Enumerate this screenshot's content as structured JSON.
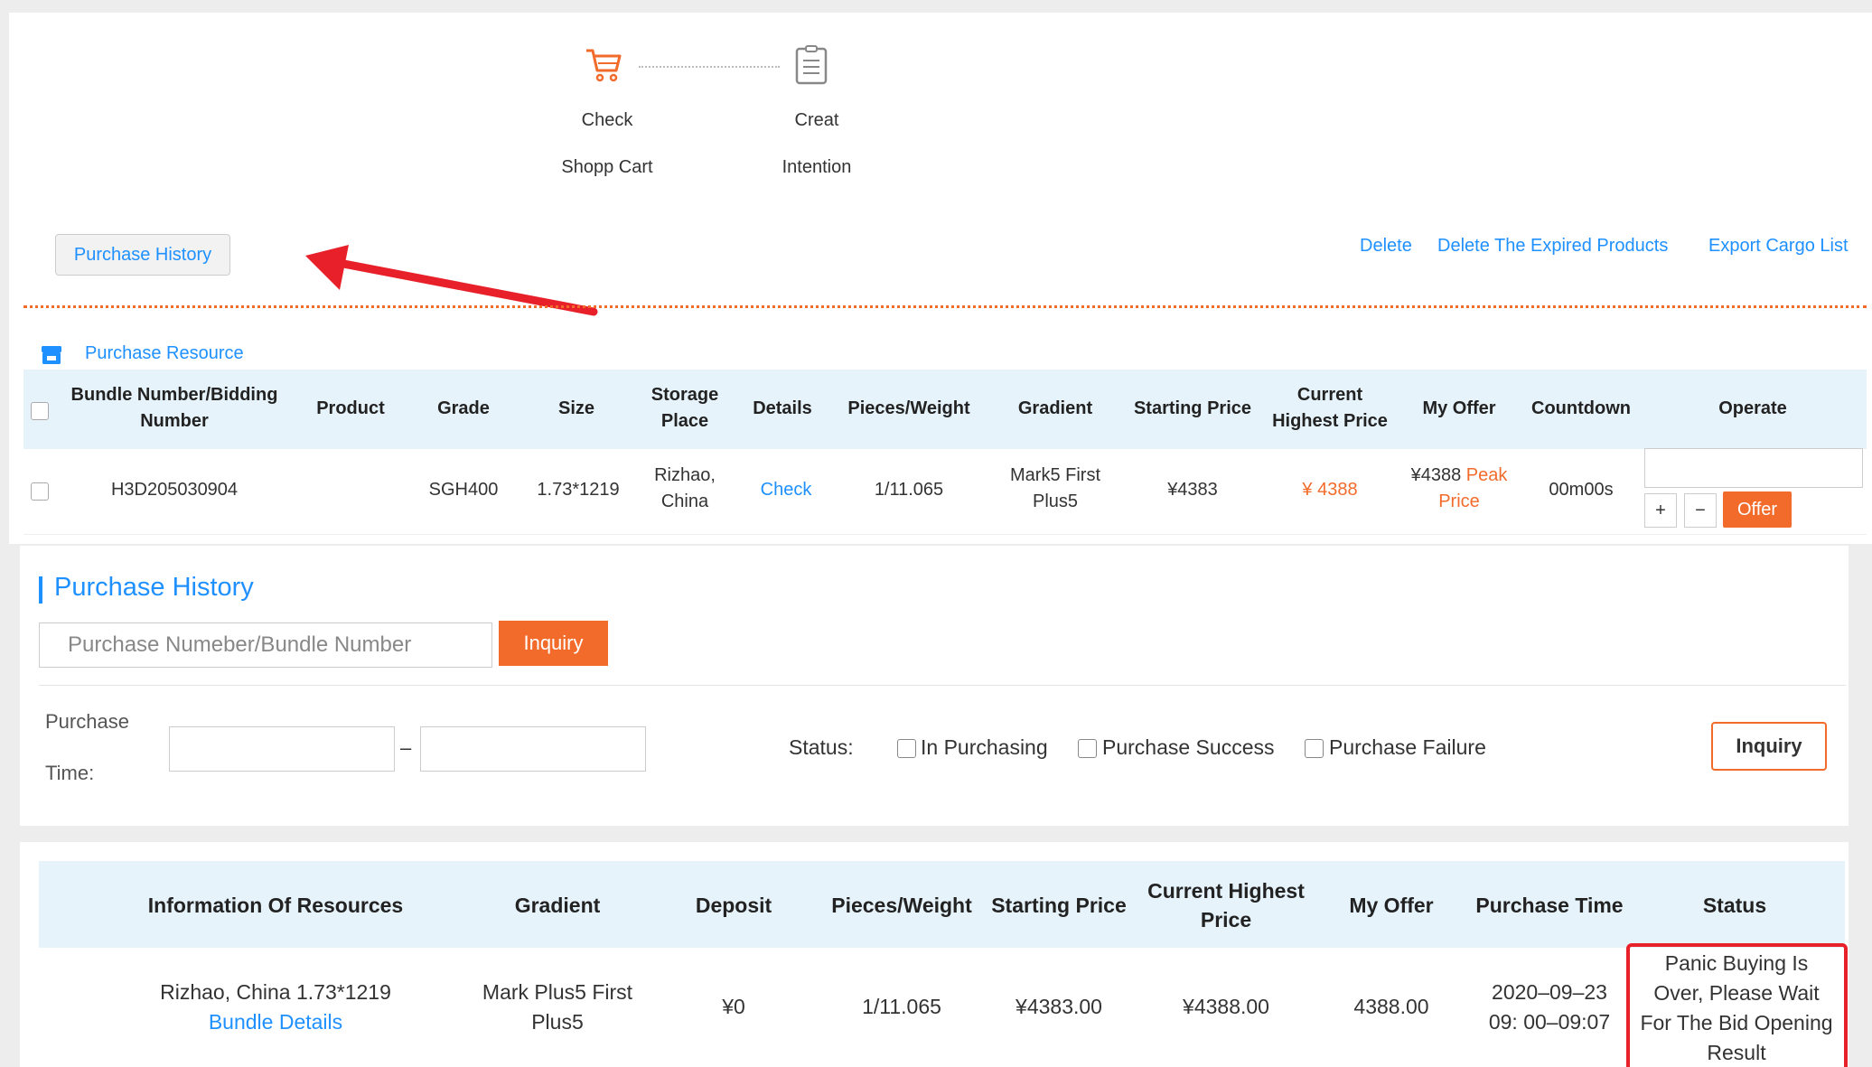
{
  "steps": [
    {
      "icon": "cart-icon",
      "line1": "Check",
      "line2": "Shopp Cart"
    },
    {
      "icon": "document-list-icon",
      "line1": "Creat",
      "line2": "Intention"
    }
  ],
  "toolbar": {
    "purchase_history_button": "Purchase History",
    "links": [
      "Delete",
      "Delete The Expired Products",
      "Export Cargo List"
    ]
  },
  "purchase_resource": {
    "icon": "store-icon",
    "label": "Purchase Resource",
    "headers": {
      "bundle": [
        "Bundle Number/Bidding",
        "Number"
      ],
      "product": "Product",
      "grade": "Grade",
      "size": "Size",
      "storage": [
        "Storage",
        "Place"
      ],
      "details": "Details",
      "pieces": "Pieces/Weight",
      "gradient": "Gradient",
      "starting": "Starting Price",
      "current": [
        "Current",
        "Highest Price"
      ],
      "my_offer": "My Offer",
      "countdown": "Countdown",
      "operate": "Operate"
    },
    "row": {
      "bundle": "H3D205030904",
      "product": "",
      "grade": "SGH400",
      "size": "1.73*1219",
      "storage": [
        "Rizhao,",
        "China"
      ],
      "details": "Check",
      "pieces": "1/11.065",
      "gradient": [
        "Mark5 First",
        "Plus5"
      ],
      "starting": "¥4383",
      "current": "¥ 4388",
      "my_offer_value": "¥4388",
      "my_offer_tag1": "Peak",
      "my_offer_tag2": "Price",
      "countdown": "00m00s",
      "plus": "+",
      "minus": "−",
      "offer_button": "Offer"
    }
  },
  "purchase_history": {
    "title": "Purchase History",
    "search_placeholder": "Purchase  Numeber/Bundle Number",
    "inquiry_button": "Inquiry",
    "time_label_1": "Purchase",
    "time_label_2": "Time:",
    "date_separator": "–",
    "status_label": "Status:",
    "status_options": [
      "In Purchasing",
      "Purchase Success",
      "Purchase Failure"
    ],
    "inquiry_button_2": "Inquiry",
    "table": {
      "headers": {
        "info": "Information Of Resources",
        "gradient": "Gradient",
        "deposit": "Deposit",
        "pieces": "Pieces/Weight",
        "starting": "Starting Price",
        "current": [
          "Current Highest",
          "Price"
        ],
        "my_offer": "My Offer",
        "purchase_time": "Purchase Time",
        "status": "Status"
      },
      "row": {
        "info": "Rizhao, China 1.73*1219",
        "bundle_link": "Bundle Details",
        "gradient": [
          "Mark Plus5  First",
          "Plus5"
        ],
        "deposit": "¥0",
        "pieces": "1/11.065",
        "starting": "¥4383.00",
        "current": "¥4388.00",
        "my_offer": "4388.00",
        "purchase_time": [
          "2020–09–23",
          "09: 00–09:07"
        ],
        "status": [
          "Panic Buying Is",
          "Over,  Please Wait",
          "For The Bid Opening",
          "Result"
        ]
      }
    }
  },
  "colors": {
    "accent_orange": "#f26b2b",
    "link_blue": "#1e90ff",
    "header_bg": "#e6f3fb",
    "highlight_red": "#e8202a"
  }
}
